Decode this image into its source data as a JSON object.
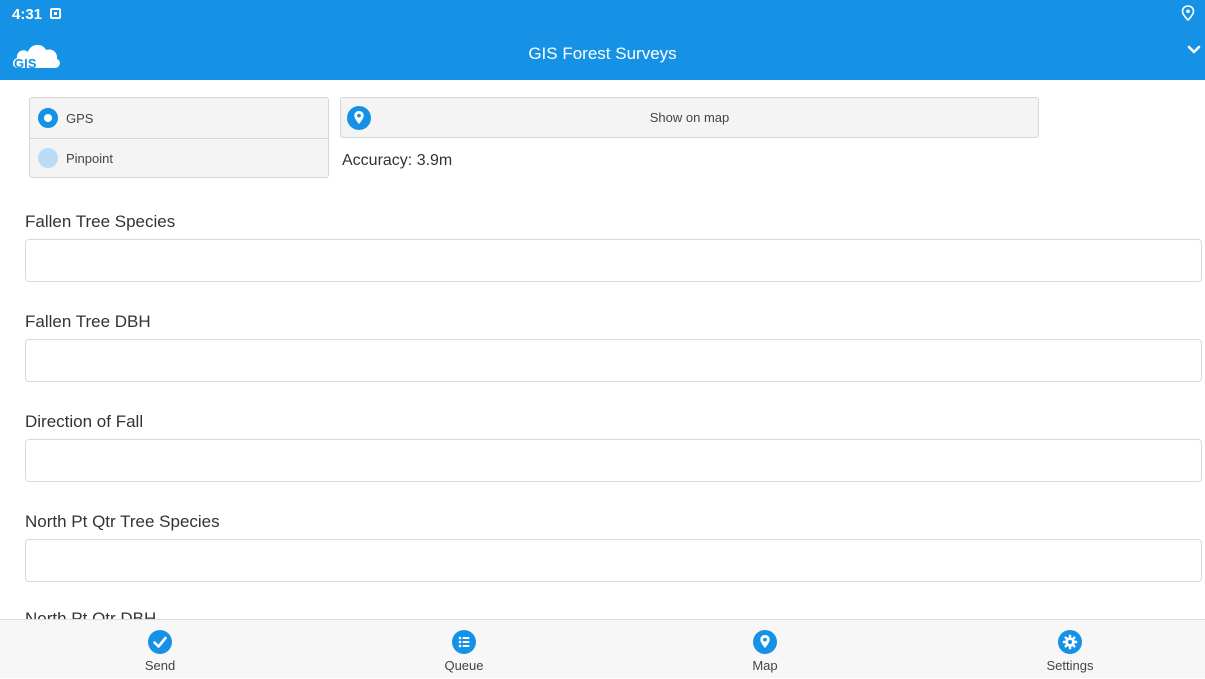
{
  "status_bar": {
    "time": "4:31"
  },
  "header": {
    "logo_text": "GIS",
    "title": "GIS Forest Surveys"
  },
  "location": {
    "modes": [
      {
        "label": "GPS",
        "selected": true
      },
      {
        "label": "Pinpoint",
        "selected": false
      }
    ],
    "show_on_map_label": "Show on map",
    "accuracy": "Accuracy: 3.9m"
  },
  "fields": [
    {
      "label": "Fallen Tree Species",
      "value": ""
    },
    {
      "label": "Fallen Tree DBH",
      "value": ""
    },
    {
      "label": "Direction of Fall",
      "value": ""
    },
    {
      "label": "North Pt Qtr Tree Species",
      "value": ""
    },
    {
      "label": "North Pt Qtr DBH",
      "value": ""
    }
  ],
  "bottom_nav": [
    {
      "label": "Send",
      "icon": "check-icon"
    },
    {
      "label": "Queue",
      "icon": "list-icon"
    },
    {
      "label": "Map",
      "icon": "map-pin-icon"
    },
    {
      "label": "Settings",
      "icon": "gear-icon"
    }
  ],
  "colors": {
    "accent": "#1592e6",
    "radio_off": "#b7dcf3"
  }
}
